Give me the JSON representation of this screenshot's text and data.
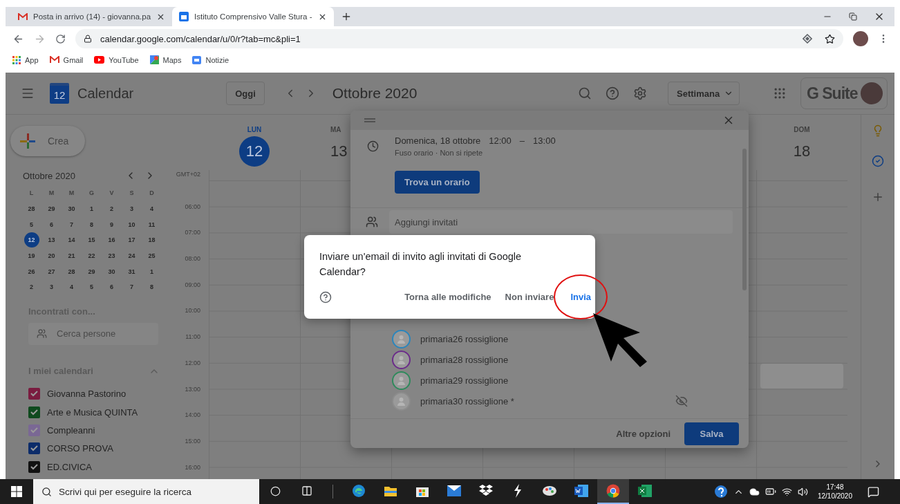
{
  "browser": {
    "tabs": [
      {
        "title": "Posta in arrivo (14) - giovanna.pa",
        "kind": "mail",
        "selected": false
      },
      {
        "title": "Istituto Comprensivo Valle Stura -",
        "kind": "calendar",
        "selected": true
      }
    ],
    "url": "calendar.google.com/calendar/u/0/r?tab=mc&pli=1",
    "bookmarks": [
      {
        "label": "App",
        "kind": "apps"
      },
      {
        "label": "Gmail",
        "kind": "gmail"
      },
      {
        "label": "YouTube",
        "kind": "youtube"
      },
      {
        "label": "Maps",
        "kind": "maps"
      },
      {
        "label": "Notizie",
        "kind": "news"
      }
    ]
  },
  "toolbar": {
    "logo_date": "12",
    "app_name": "Calendar",
    "today_button": "Oggi",
    "period": "Ottobre 2020",
    "view": "Settimana",
    "brand": "G Suite"
  },
  "sidebar": {
    "create": "Crea",
    "mini_calendar": {
      "title": "Ottobre 2020",
      "weekdays": [
        "L",
        "M",
        "M",
        "G",
        "V",
        "S",
        "D"
      ],
      "weeks": [
        [
          {
            "day": "28",
            "selected": false
          },
          {
            "day": "29",
            "selected": false
          },
          {
            "day": "30",
            "selected": false
          },
          {
            "day": "1",
            "selected": false
          },
          {
            "day": "2",
            "selected": false
          },
          {
            "day": "3",
            "selected": false
          },
          {
            "day": "4",
            "selected": false
          }
        ],
        [
          {
            "day": "5",
            "selected": false
          },
          {
            "day": "6",
            "selected": false
          },
          {
            "day": "7",
            "selected": false
          },
          {
            "day": "8",
            "selected": false
          },
          {
            "day": "9",
            "selected": false
          },
          {
            "day": "10",
            "selected": false
          },
          {
            "day": "11",
            "selected": false
          }
        ],
        [
          {
            "day": "12",
            "selected": true
          },
          {
            "day": "13",
            "selected": false
          },
          {
            "day": "14",
            "selected": false
          },
          {
            "day": "15",
            "selected": false
          },
          {
            "day": "16",
            "selected": false
          },
          {
            "day": "17",
            "selected": false
          },
          {
            "day": "18",
            "selected": false
          }
        ],
        [
          {
            "day": "19",
            "selected": false
          },
          {
            "day": "20",
            "selected": false
          },
          {
            "day": "21",
            "selected": false
          },
          {
            "day": "22",
            "selected": false
          },
          {
            "day": "23",
            "selected": false
          },
          {
            "day": "24",
            "selected": false
          },
          {
            "day": "25",
            "selected": false
          }
        ],
        [
          {
            "day": "26",
            "selected": false
          },
          {
            "day": "27",
            "selected": false
          },
          {
            "day": "28",
            "selected": false
          },
          {
            "day": "29",
            "selected": false
          },
          {
            "day": "30",
            "selected": false
          },
          {
            "day": "31",
            "selected": false
          },
          {
            "day": "1",
            "selected": false
          }
        ],
        [
          {
            "day": "2",
            "selected": false
          },
          {
            "day": "3",
            "selected": false
          },
          {
            "day": "4",
            "selected": false
          },
          {
            "day": "5",
            "selected": false
          },
          {
            "day": "6",
            "selected": false
          },
          {
            "day": "7",
            "selected": false
          },
          {
            "day": "8",
            "selected": false
          }
        ]
      ]
    },
    "meet": {
      "title": "Incontrati con...",
      "placeholder": "Cerca persone"
    },
    "my_calendars": {
      "title": "I miei calendari",
      "expanded": true,
      "items": [
        {
          "name": "Giovanna Pastorino",
          "checked": true,
          "color": "#7a1c40"
        },
        {
          "name": "Arte e Musica QUINTA",
          "checked": true,
          "color": "#0f4a1e"
        },
        {
          "name": "Compleanni",
          "checked": true,
          "color": "#7a6894"
        },
        {
          "name": "CORSO PROVA",
          "checked": true,
          "color": "#0c2c6a"
        },
        {
          "name": "ED.CIVICA",
          "checked": true,
          "color": "#111111"
        }
      ]
    }
  },
  "week": {
    "days": [
      {
        "weekday": "LUN",
        "date": "12",
        "selected": true
      },
      {
        "weekday": "MA",
        "date": "13",
        "selected": false
      },
      {
        "weekday": "DOM",
        "date": "18",
        "selected": false
      }
    ],
    "timezone": "GMT+02",
    "hours": [
      "06:00",
      "07:00",
      "08:00",
      "09:00",
      "10:00",
      "11:00",
      "12:00",
      "13:00",
      "14:00",
      "15:00",
      "16:00"
    ]
  },
  "editor": {
    "date": "Domenica, 18 ottobre",
    "start": "12:00",
    "dash": "–",
    "end": "13:00",
    "details": "Fuso orario · Non si ripete",
    "find_time": "Trova un orario",
    "guests_placeholder": "Aggiungi invitati",
    "guests": [
      {
        "name": "primaria26 rossiglione",
        "color": "#2a86bd",
        "hidden": false
      },
      {
        "name": "primaria28 rossiglione",
        "color": "#6b2c8a",
        "hidden": false
      },
      {
        "name": "primaria29 rossiglione",
        "color": "#2f8a5c",
        "hidden": false
      },
      {
        "name": "primaria30 rossiglione *",
        "color": "#8c8c8c",
        "hidden": true
      }
    ],
    "more_options": "Altre opzioni",
    "save": "Salva"
  },
  "dialog": {
    "message": "Inviare un'email di invito agli invitati di Google Calendar?",
    "actions": [
      {
        "label": "Torna alle modifiche",
        "primary": false,
        "circled": false
      },
      {
        "label": "Non inviare",
        "primary": false,
        "circled": false
      },
      {
        "label": "Invia",
        "primary": true,
        "circled": true
      }
    ]
  },
  "taskbar": {
    "search_placeholder": "Scrivi qui per eseguire la ricerca",
    "apps": [
      {
        "kind": "edge",
        "active": false
      },
      {
        "kind": "explorer",
        "active": false
      },
      {
        "kind": "store",
        "active": false
      },
      {
        "kind": "mail",
        "active": false
      },
      {
        "kind": "dropbox",
        "active": false
      },
      {
        "kind": "bolt",
        "active": false
      },
      {
        "kind": "paint",
        "active": false
      },
      {
        "kind": "word",
        "active": false
      },
      {
        "kind": "chrome",
        "active": true
      },
      {
        "kind": "excel",
        "active": false
      }
    ],
    "time": "17:48",
    "date": "12/10/2020"
  }
}
